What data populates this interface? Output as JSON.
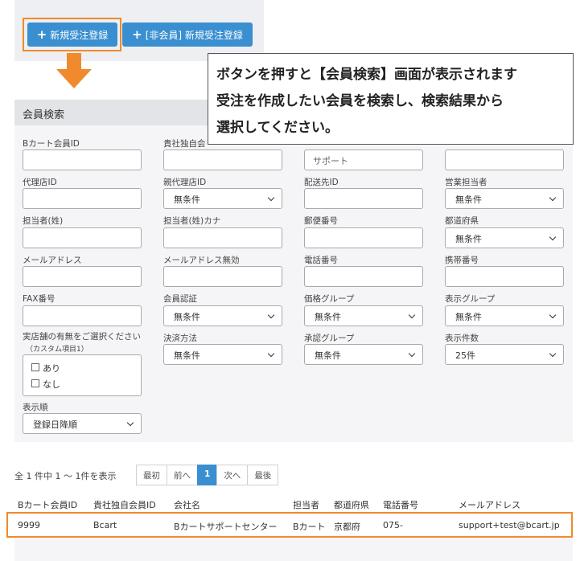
{
  "top_buttons": {
    "new_order": "新規受注登録",
    "non_member_order": "[非会員] 新規受注登録"
  },
  "callout": {
    "line1": "ボタンを押すと【会員検索】画面が表示されます",
    "line2": "受注を作成したい会員を検索し、検索結果から",
    "line3": "選択してください。"
  },
  "search": {
    "title": "会員検索",
    "labels": {
      "bcart_id": "Bカート会員ID",
      "company_id": "貴社独自会",
      "agency_id": "代理店ID",
      "parent_agency_id": "親代理店ID",
      "delivery_id": "配送先ID",
      "sales_rep": "営業担当者",
      "contact_last": "担当者(姓)",
      "contact_last_kana": "担当者(姓)カナ",
      "postal": "郵便番号",
      "prefecture": "都道府県",
      "email": "メールアドレス",
      "email_invalid": "メールアドレス無効",
      "phone": "電話番号",
      "mobile": "携帯番号",
      "fax": "FAX番号",
      "member_auth": "会員認証",
      "price_group": "価格グループ",
      "display_group": "表示グループ",
      "store_question": "実店舗の有無をご選択ください",
      "store_sub": "（カスタム項目1）",
      "payment": "決済方法",
      "approval_group": "承認グループ",
      "per_page": "表示件数",
      "sort": "表示順"
    },
    "values": {
      "company_name_value": "サポート",
      "no_condition": "無条件",
      "per_page_value": "25件",
      "sort_value": "登録日降順"
    },
    "checkbox": {
      "yes": "あり",
      "no": "なし"
    }
  },
  "pagination": {
    "summary": "全 1 件中 1 ～ 1件を表示",
    "first": "最初",
    "prev": "前へ",
    "current": "1",
    "next": "次へ",
    "last": "最後"
  },
  "table": {
    "headers": [
      "Bカート会員ID",
      "貴社独自会員ID",
      "会社名",
      "担当者",
      "都道府県",
      "電話番号",
      "メールアドレス"
    ],
    "row": [
      "9999",
      "Bcart",
      "Bカートサポートセンター",
      "Bカート",
      "京都府",
      "075-",
      "support+test@bcart.jp"
    ]
  },
  "colors": {
    "accent": "#3a8fd1",
    "highlight": "#f08a2c"
  },
  "icons": [
    "plus-icon",
    "arrow-down-icon",
    "chevron-down-icon"
  ]
}
